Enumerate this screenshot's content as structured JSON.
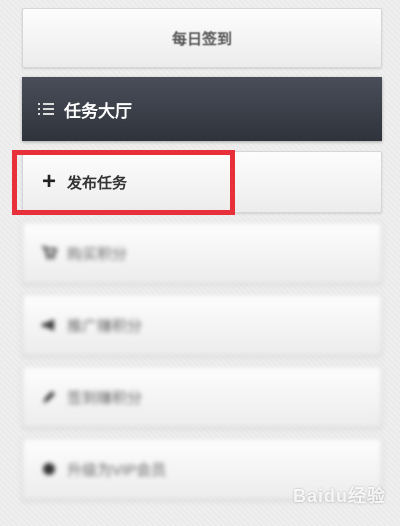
{
  "menu": {
    "checkin_label": "每日签到",
    "hall_label": "任务大厅",
    "publish_label": "发布任务",
    "items": [
      {
        "label": "购买积分",
        "icon": "cart-icon"
      },
      {
        "label": "推广赚积分",
        "icon": "megaphone-icon"
      },
      {
        "label": "签到赚积分",
        "icon": "pencil-icon"
      },
      {
        "label": "升级为VIP会员",
        "icon": "circle-icon"
      }
    ]
  },
  "colors": {
    "hall_bg": "#3b3f48",
    "highlight": "#e8303b"
  },
  "watermark": "Baidu经验"
}
